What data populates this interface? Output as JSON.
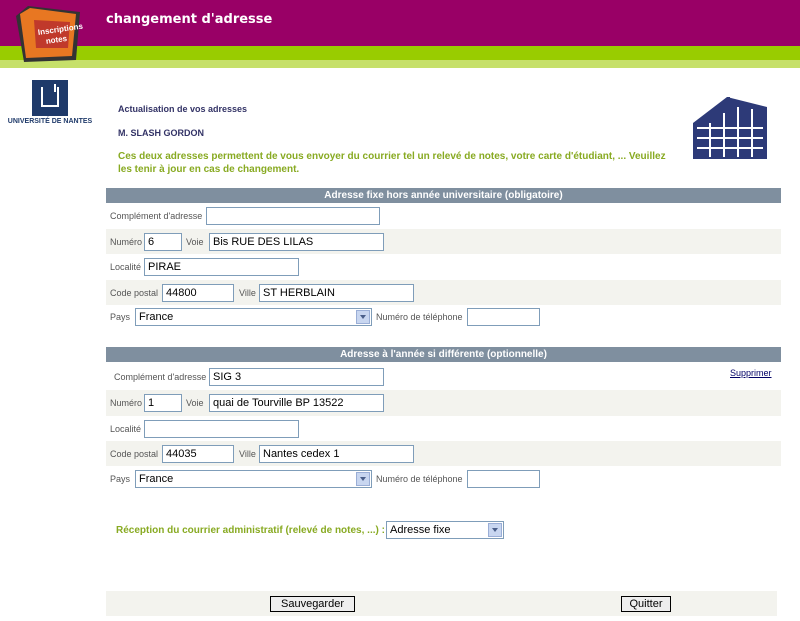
{
  "header": {
    "title": "changement d'adresse",
    "logo_text": "Inscriptions notes"
  },
  "university": {
    "name": "UNIVERSITÉ DE NANTES"
  },
  "intro": {
    "title": "Actualisation de vos adresses",
    "student_name": "M. SLASH GORDON",
    "info": "Ces deux adresses permettent de vous envoyer du courrier tel un relevé de notes, votre carte d'étudiant, ... Veuillez les tenir à jour en cas de changement."
  },
  "section1": {
    "heading": "Adresse fixe hors année universitaire (obligatoire)",
    "labels": {
      "complement": "Complément d'adresse",
      "numero": "Numéro",
      "voie": "Voie",
      "localite": "Localité",
      "code_postal": "Code postal",
      "ville": "Ville",
      "pays": "Pays",
      "telephone": "Numéro de téléphone"
    },
    "values": {
      "complement": "",
      "numero": "6",
      "voie": "Bis RUE DES LILAS",
      "localite": "PIRAE",
      "code_postal": "44800",
      "ville": "ST HERBLAIN",
      "pays": "France",
      "telephone": ""
    }
  },
  "section2": {
    "heading": "Adresse à l'année si différente (optionnelle)",
    "delete_link": "Supprimer",
    "labels": {
      "complement": "Complément d'adresse",
      "numero": "Numéro",
      "voie": "Voie",
      "localite": "Localité",
      "code_postal": "Code postal",
      "ville": "Ville",
      "pays": "Pays",
      "telephone": "Numéro de téléphone"
    },
    "values": {
      "complement": "SIG 3",
      "numero": "1",
      "voie": "quai de Tourville BP 13522",
      "localite": "",
      "code_postal": "44035",
      "ville": "Nantes cedex 1",
      "pays": "France",
      "telephone": ""
    }
  },
  "reception": {
    "label": "Réception du courrier administratif (relevé de notes, ...) :",
    "selected": "Adresse fixe"
  },
  "buttons": {
    "save": "Sauvegarder",
    "quit": "Quitter"
  },
  "colors": {
    "header": "#990066",
    "green": "#99cc00",
    "section_head": "#7f8f9f",
    "info_text": "#88aa22"
  }
}
